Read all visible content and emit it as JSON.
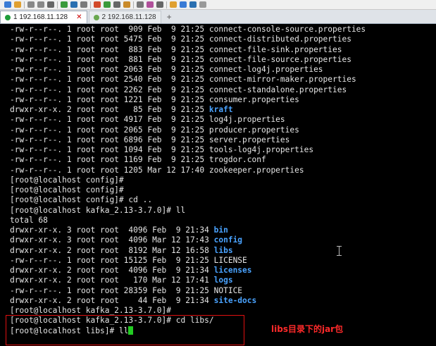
{
  "toolbar": {
    "icons": [
      "new-session-icon",
      "open-folder-icon",
      "reconnect-icon",
      "disconnect-icon",
      "find-icon",
      "transfer-icon",
      "globe-icon",
      "compose-icon",
      "color-scheme-icon",
      "sftp-icon",
      "fullscreen-icon",
      "lock-icon",
      "keyboard-icon",
      "highlight-icon",
      "script-icon",
      "add-icon",
      "layout-icon",
      "help-icon",
      "chat-icon"
    ]
  },
  "tabs": [
    {
      "label": "1 192.168.11.128",
      "active": true
    },
    {
      "label": "2 192.168.11.128",
      "active": false
    }
  ],
  "terminal": {
    "lines": [
      [
        {
          "t": "-rw-r--r--. 1 root root  909 Feb  9 21:25 connect-console-source.properties"
        }
      ],
      [
        {
          "t": "-rw-r--r--. 1 root root 5475 Feb  9 21:25 connect-distributed.properties"
        }
      ],
      [
        {
          "t": "-rw-r--r--. 1 root root  883 Feb  9 21:25 connect-file-sink.properties"
        }
      ],
      [
        {
          "t": "-rw-r--r--. 1 root root  881 Feb  9 21:25 connect-file-source.properties"
        }
      ],
      [
        {
          "t": "-rw-r--r--. 1 root root 2063 Feb  9 21:25 connect-log4j.properties"
        }
      ],
      [
        {
          "t": "-rw-r--r--. 1 root root 2540 Feb  9 21:25 connect-mirror-maker.properties"
        }
      ],
      [
        {
          "t": "-rw-r--r--. 1 root root 2262 Feb  9 21:25 connect-standalone.properties"
        }
      ],
      [
        {
          "t": "-rw-r--r--. 1 root root 1221 Feb  9 21:25 consumer.properties"
        }
      ],
      [
        {
          "t": "drwxr-xr-x. 2 root root   85 Feb  9 21:25 "
        },
        {
          "t": "kraft",
          "c": "dir"
        }
      ],
      [
        {
          "t": "-rw-r--r--. 1 root root 4917 Feb  9 21:25 log4j.properties"
        }
      ],
      [
        {
          "t": "-rw-r--r--. 1 root root 2065 Feb  9 21:25 producer.properties"
        }
      ],
      [
        {
          "t": "-rw-r--r--. 1 root root 6896 Feb  9 21:25 server.properties"
        }
      ],
      [
        {
          "t": "-rw-r--r--. 1 root root 1094 Feb  9 21:25 tools-log4j.properties"
        }
      ],
      [
        {
          "t": "-rw-r--r--. 1 root root 1169 Feb  9 21:25 trogdor.conf"
        }
      ],
      [
        {
          "t": "-rw-r--r--. 1 root root 1205 Mar 12 17:40 zookeeper.properties"
        }
      ],
      [
        {
          "t": "[root@localhost config]#"
        }
      ],
      [
        {
          "t": "[root@localhost config]#"
        }
      ],
      [
        {
          "t": "[root@localhost config]# cd .."
        }
      ],
      [
        {
          "t": "[root@localhost kafka_2.13-3.7.0]# ll"
        }
      ],
      [
        {
          "t": "total 68"
        }
      ],
      [
        {
          "t": "drwxr-xr-x. 3 root root  4096 Feb  9 21:34 "
        },
        {
          "t": "bin",
          "c": "dir"
        }
      ],
      [
        {
          "t": "drwxr-xr-x. 3 root root  4096 Mar 12 17:43 "
        },
        {
          "t": "config",
          "c": "dir"
        }
      ],
      [
        {
          "t": "drwxr-xr-x. 2 root root  8192 Mar 12 16:58 "
        },
        {
          "t": "libs",
          "c": "dir"
        }
      ],
      [
        {
          "t": "-rw-r--r--. 1 root root 15125 Feb  9 21:25 LICENSE"
        }
      ],
      [
        {
          "t": "drwxr-xr-x. 2 root root  4096 Feb  9 21:34 "
        },
        {
          "t": "licenses",
          "c": "dir"
        }
      ],
      [
        {
          "t": "drwxr-xr-x. 2 root root   170 Mar 12 17:41 "
        },
        {
          "t": "logs",
          "c": "dir"
        }
      ],
      [
        {
          "t": "-rw-r--r--. 1 root root 28359 Feb  9 21:25 NOTICE"
        }
      ],
      [
        {
          "t": "drwxr-xr-x. 2 root root    44 Feb  9 21:34 "
        },
        {
          "t": "site-docs",
          "c": "dir"
        }
      ],
      [
        {
          "t": "[root@localhost kafka_2.13-3.7.0]#"
        }
      ],
      [
        {
          "t": "[root@localhost kafka_2.13-3.7.0]# cd libs/"
        }
      ],
      [
        {
          "t": "[root@localhost libs]# ll"
        }
      ]
    ],
    "colors": {
      "foreground": "#e6e6e6",
      "directory": "#4aa3ff",
      "cursor": "#22cc22",
      "background": "#000000"
    }
  },
  "annotation": {
    "text": "libs目录下的jar包",
    "color": "#ff2a2a"
  }
}
